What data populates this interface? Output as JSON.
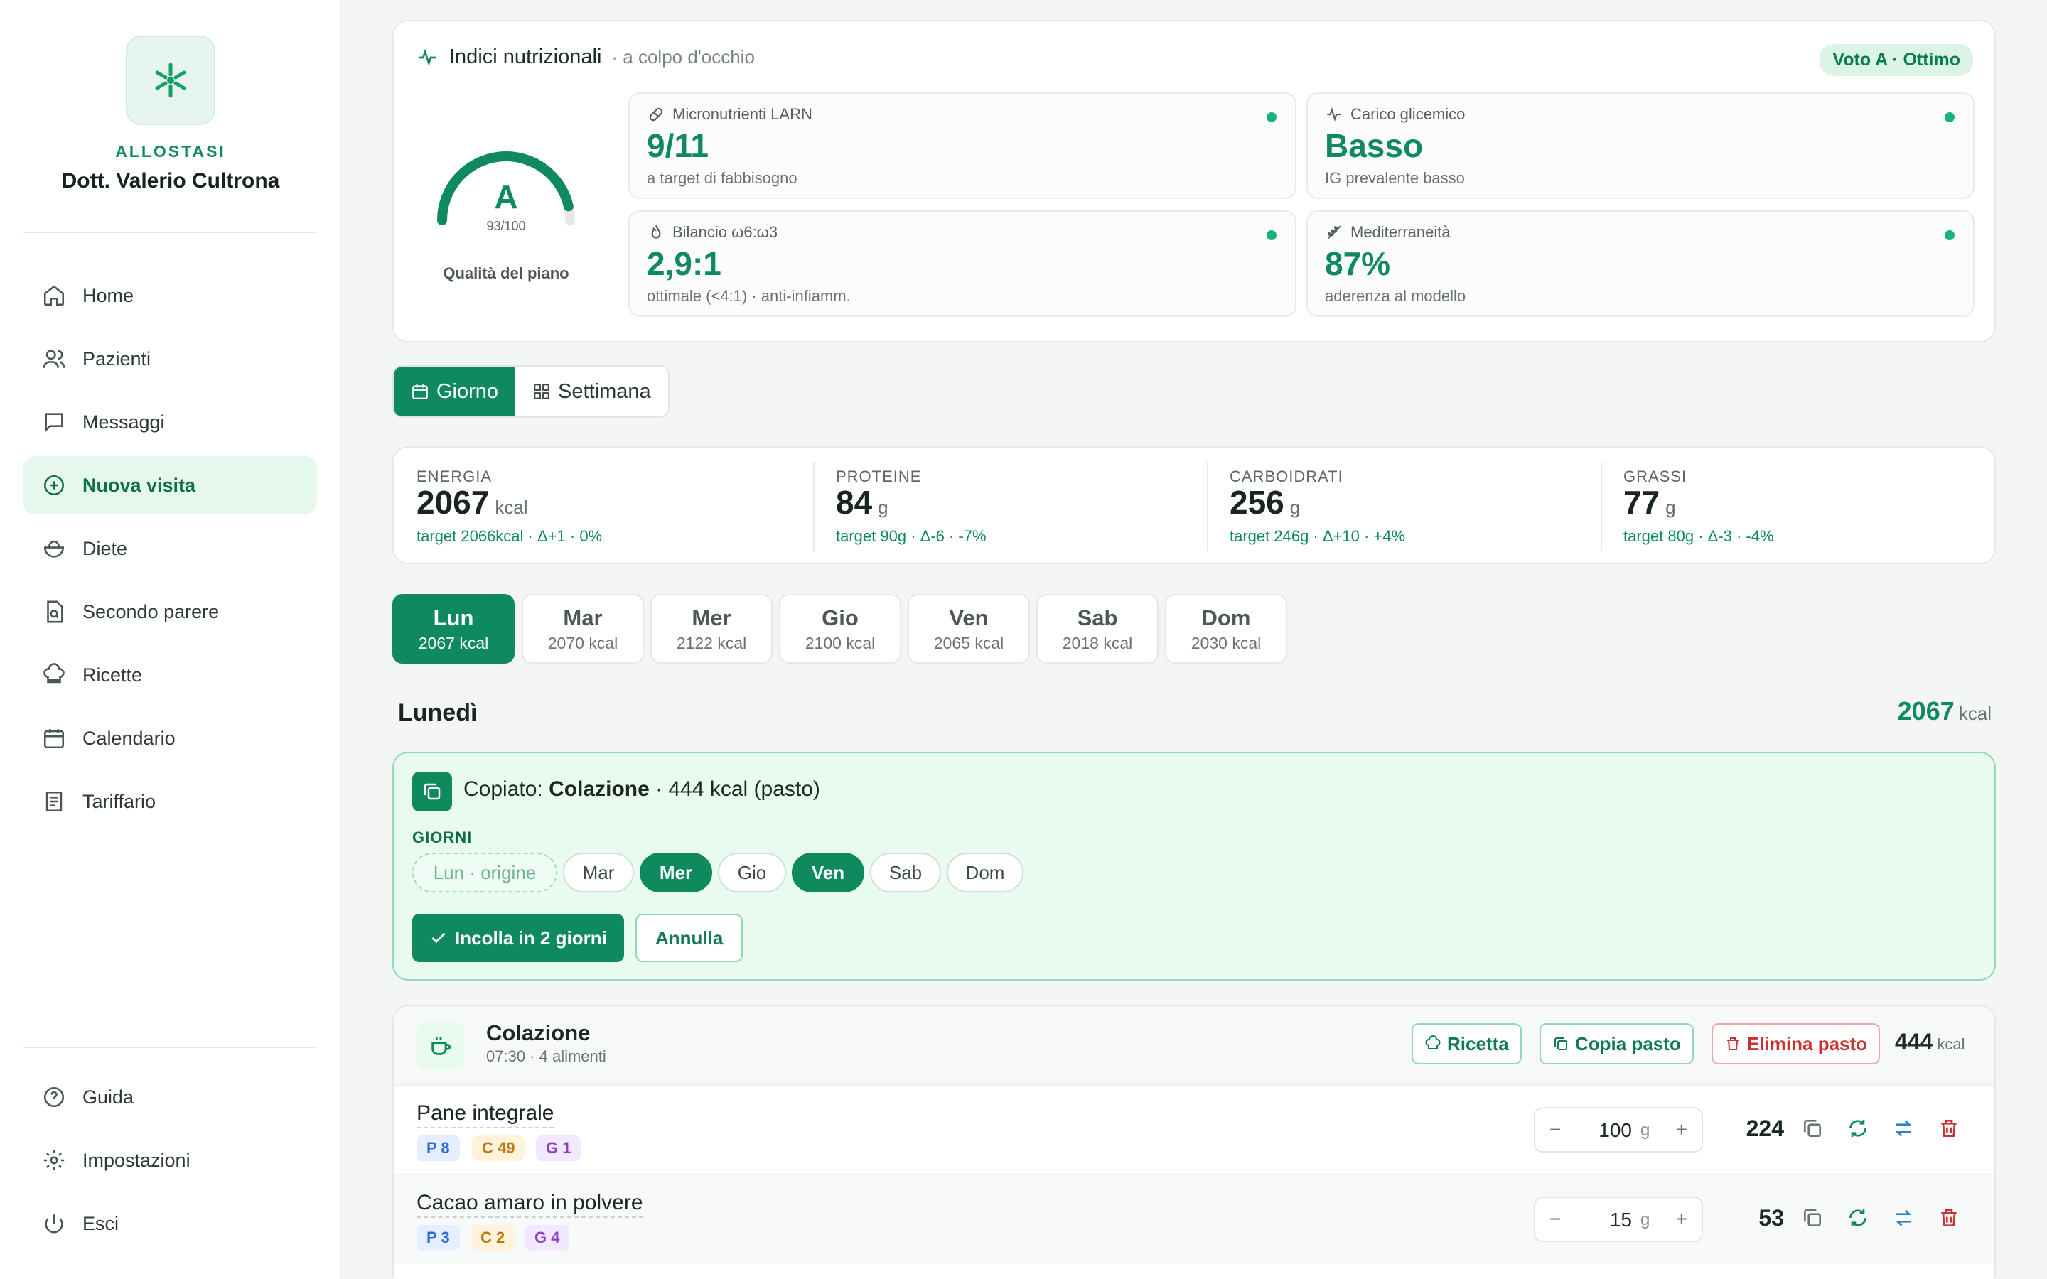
{
  "sidebar": {
    "brand": "ALLOSTASI",
    "doctor": "Dott. Valerio Cultrona",
    "nav": [
      {
        "label": "Home",
        "icon": "home-icon"
      },
      {
        "label": "Pazienti",
        "icon": "users-icon"
      },
      {
        "label": "Messaggi",
        "icon": "message-icon"
      },
      {
        "label": "Nuova visita",
        "icon": "plus-circle-icon",
        "active": true
      },
      {
        "label": "Diete",
        "icon": "salad-icon"
      },
      {
        "label": "Secondo parere",
        "icon": "file-search-icon"
      },
      {
        "label": "Ricette",
        "icon": "chef-hat-icon"
      },
      {
        "label": "Calendario",
        "icon": "calendar-icon"
      },
      {
        "label": "Tariffario",
        "icon": "receipt-icon"
      }
    ],
    "footer": [
      {
        "label": "Guida",
        "icon": "help-icon"
      },
      {
        "label": "Impostazioni",
        "icon": "settings-icon"
      },
      {
        "label": "Esci",
        "icon": "power-icon"
      }
    ]
  },
  "indices": {
    "title": "Indici nutrizionali",
    "subtitle": "· a colpo d'occhio",
    "badge": "Voto A · Ottimo",
    "gauge": {
      "grade": "A",
      "score_text": "93/100",
      "score": 93,
      "max": 100,
      "label": "Qualità del piano"
    },
    "tiles": [
      {
        "label": "Micronutrienti LARN",
        "value": "9/11",
        "sub": "a target di fabbisogno",
        "icon": "pill-icon"
      },
      {
        "label": "Carico glicemico",
        "value": "Basso",
        "sub": "IG prevalente basso",
        "icon": "activity-icon"
      },
      {
        "label": "Bilancio ω6:ω3",
        "value": "2,9:1",
        "sub": "ottimale (<4:1) · anti-infiamm.",
        "icon": "flame-icon"
      },
      {
        "label": "Mediterraneità",
        "value": "87%",
        "sub": "aderenza al modello",
        "icon": "wheat-icon"
      }
    ]
  },
  "view_toggle": {
    "day": "Giorno",
    "week": "Settimana",
    "selected": "day"
  },
  "macros": [
    {
      "label": "ENERGIA",
      "value": "2067",
      "unit": "kcal",
      "target": "target 2066kcal · Δ+1 · 0%"
    },
    {
      "label": "PROTEINE",
      "value": "84",
      "unit": "g",
      "target": "target 90g · Δ-6 · -7%"
    },
    {
      "label": "CARBOIDRATI",
      "value": "256",
      "unit": "g",
      "target": "target 246g · Δ+10 · +4%"
    },
    {
      "label": "GRASSI",
      "value": "77",
      "unit": "g",
      "target": "target 80g · Δ-3 · -4%"
    }
  ],
  "days": [
    {
      "name": "Lun",
      "kcal": "2067 kcal",
      "active": true
    },
    {
      "name": "Mar",
      "kcal": "2070 kcal"
    },
    {
      "name": "Mer",
      "kcal": "2122 kcal"
    },
    {
      "name": "Gio",
      "kcal": "2100 kcal"
    },
    {
      "name": "Ven",
      "kcal": "2065 kcal"
    },
    {
      "name": "Sab",
      "kcal": "2018 kcal"
    },
    {
      "name": "Dom",
      "kcal": "2030 kcal"
    }
  ],
  "day_detail": {
    "title": "Lunedì",
    "kcal": "2067",
    "unit": "kcal"
  },
  "copy_panel": {
    "prefix": "Copiato:",
    "meal": "Colazione",
    "suffix": "· 444 kcal (pasto)",
    "days_label": "GIORNI",
    "chips": [
      {
        "label": "Lun · origine",
        "state": "origin"
      },
      {
        "label": "Mar",
        "state": "off"
      },
      {
        "label": "Mer",
        "state": "on"
      },
      {
        "label": "Gio",
        "state": "off"
      },
      {
        "label": "Ven",
        "state": "on"
      },
      {
        "label": "Sab",
        "state": "off"
      },
      {
        "label": "Dom",
        "state": "off"
      }
    ],
    "paste_label": "Incolla in 2 giorni",
    "cancel_label": "Annulla"
  },
  "meal": {
    "title": "Colazione",
    "sub": "07:30 · 4 alimenti",
    "recipe_label": "Ricetta",
    "copy_label": "Copia pasto",
    "delete_label": "Elimina pasto",
    "kcal": "444",
    "unit": "kcal",
    "foods": [
      {
        "name": "Pane integrale",
        "p": "P 8",
        "c": "C 49",
        "g": "G 1",
        "qty": "100",
        "unit": "g",
        "kcal": "224"
      },
      {
        "name": "Cacao amaro in polvere",
        "p": "P 3",
        "c": "C 2",
        "g": "G 4",
        "qty": "15",
        "unit": "g",
        "kcal": "53"
      }
    ]
  },
  "colors": {
    "accent": "#0f8a5f",
    "accent_light": "#e9faf1",
    "danger": "#c93232"
  }
}
